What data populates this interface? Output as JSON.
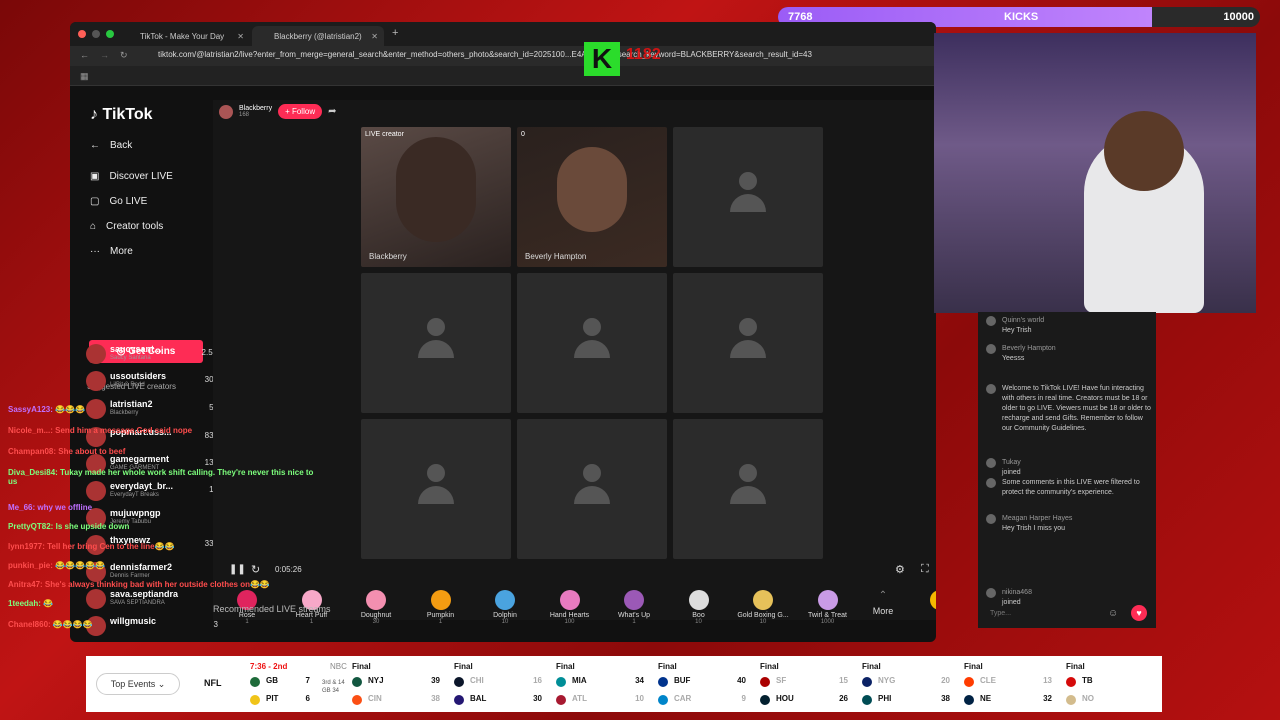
{
  "kicks": {
    "current": "7768",
    "label": "KICKS",
    "goal": "10000",
    "progress": 0.7768
  },
  "overlay": {
    "k_letter": "K",
    "k_count": "1182"
  },
  "browser": {
    "tabs": [
      {
        "title": "TikTok - Make Your Day"
      },
      {
        "title": "Blackberry (@latristian2)"
      }
    ],
    "url": "tiktok.com/@latristian2/live?enter_from_merge=general_search&enter_method=others_photo&search_id=2025100...E4AD1A3D&search_keyword=BLACKBERRY&search_result_id=43"
  },
  "tiktok": {
    "logo": "TikTok",
    "nav": [
      {
        "label": "Back",
        "icon": "back-arrow-icon"
      },
      {
        "label": "Discover LIVE",
        "icon": "live-icon"
      },
      {
        "label": "Go LIVE",
        "icon": "camera-icon"
      },
      {
        "label": "Creator tools",
        "icon": "tools-icon"
      },
      {
        "label": "More",
        "icon": "more-icon"
      }
    ],
    "get_coins": "Get Coins",
    "suggested_title": "Suggested LIVE creators",
    "creators": [
      {
        "name": "saucysant...",
        "sub": "Saucy Santana",
        "count": "2.5K"
      },
      {
        "name": "ussoutsiders",
        "sub": "LilBit & Redd",
        "count": "302"
      },
      {
        "name": "latristian2",
        "sub": "Blackberry",
        "count": "56"
      },
      {
        "name": "popmart.uss...",
        "sub": "",
        "count": "834"
      },
      {
        "name": "gamegarment",
        "sub": "GAME GARMENT",
        "count": "137"
      },
      {
        "name": "everydayt_br...",
        "sub": "EverydayT Breaks",
        "count": "14"
      },
      {
        "name": "mujuwpngp",
        "sub": "Jeremy Tabubu",
        "count": "4"
      },
      {
        "name": "thxynewz",
        "sub": "",
        "count": "332"
      },
      {
        "name": "dennisfarmer2",
        "sub": "Dennis Farmer",
        "count": "1"
      },
      {
        "name": "sava.septiandra",
        "sub": "SAVA SEPTIANDRA",
        "count": "7"
      },
      {
        "name": "willgmusic",
        "sub": "",
        "count": "3"
      }
    ],
    "host": {
      "name": "Blackberry",
      "likes": "168",
      "follow": "+ Follow"
    },
    "cells": [
      {
        "label": "LIVE creator",
        "name": "Blackberry"
      },
      {
        "label": "0",
        "name": "Beverly Hampton"
      }
    ],
    "timer": "0:05:26",
    "gifts": [
      {
        "name": "Rose",
        "price": "1",
        "color": "#e0245e"
      },
      {
        "name": "Heart Puff",
        "price": "1",
        "color": "#f7a8c8"
      },
      {
        "name": "Doughnut",
        "price": "30",
        "color": "#f38fb0"
      },
      {
        "name": "Pumpkin",
        "price": "1",
        "color": "#f39c12"
      },
      {
        "name": "Dolphin",
        "price": "10",
        "color": "#4aa3df"
      },
      {
        "name": "Hand Hearts",
        "price": "100",
        "color": "#e87ac0"
      },
      {
        "name": "What's Up",
        "price": "1",
        "color": "#9b59b6"
      },
      {
        "name": "Boo",
        "price": "10",
        "color": "#dddddd"
      },
      {
        "name": "Gold Boxing G...",
        "price": "10",
        "color": "#e6c15a"
      },
      {
        "name": "Twirl & Treat",
        "price": "1000",
        "color": "#c99be6"
      }
    ],
    "more": "More",
    "balance": "1",
    "recommended": "Recommended LIVE streams"
  },
  "chat": {
    "messages": [
      {
        "user": "Quinn's world",
        "text": "Hey Trish"
      },
      {
        "user": "Beverly Hampton",
        "text": "Yeesss"
      },
      {
        "user": "",
        "text": "Welcome to TikTok LIVE! Have fun interacting with others in real time. Creators must be 18 or older to go LIVE. Viewers must be 18 or older to recharge and send Gifts. Remember to follow our Community Guidelines."
      },
      {
        "user": "Tukay",
        "text": "joined"
      },
      {
        "user": "",
        "text": "Some comments in this LIVE were filtered to protect the community's experience."
      },
      {
        "user": "Meagan Harper Hayes",
        "text": "Hey Trish I miss you"
      },
      {
        "user": "nikina468",
        "text": "joined"
      }
    ],
    "placeholder": "Type..."
  },
  "twitch_chat": [
    {
      "user": "SassyA123:",
      "text": "😂😂😂",
      "color": "#c070ff"
    },
    {
      "user": "Nicole_m...:",
      "text": "Send him a message,God said nope",
      "color": "#ff4d4d"
    },
    {
      "user": "Champan08:",
      "text": "She about to beef",
      "color": "#ff4d4d"
    },
    {
      "user": "Diva_Desi84:",
      "text": "Tukay made her whole work shift calling. They're never this nice to us",
      "color": "#7dff7d"
    },
    {
      "user": "Me_66:",
      "text": "why we offline",
      "color": "#c070ff"
    },
    {
      "user": "PrettyQT82:",
      "text": "Is she upside down",
      "color": "#7dff7d"
    },
    {
      "user": "lynn1977:",
      "text": "Tell her bring Cen to the line😂😂",
      "color": "#ff4d4d"
    },
    {
      "user": "punkin_pie:",
      "text": "😂😂😂😂😂",
      "color": "#ff4d4d"
    },
    {
      "user": "Anitra47:",
      "text": "She's always thinking bad with her outside clothes on😂😂",
      "color": "#ff4d4d"
    },
    {
      "user": "1teedah:",
      "text": "😂",
      "color": "#7dff7d"
    },
    {
      "user": "Chanel860:",
      "text": "😂😂😂😂",
      "color": "#ff4d4d"
    }
  ],
  "ticker": {
    "top_events": "Top Events",
    "league": "NFL",
    "games": [
      {
        "status": "7:36 - 2nd",
        "net": "NBC",
        "a": "GB",
        "as": "7",
        "b": "PIT",
        "bs": "6",
        "note": "3rd & 14 GB 34",
        "ac": "#1e6b3a",
        "bc": "#f0c419",
        "live": true
      },
      {
        "status": "Final",
        "a": "NYJ",
        "as": "39",
        "b": "CIN",
        "bs": "38",
        "ac": "#125740",
        "bc": "#fb4f14",
        "awin": true
      },
      {
        "status": "Final",
        "a": "CHI",
        "as": "16",
        "b": "BAL",
        "bs": "30",
        "ac": "#0b162a",
        "bc": "#241773",
        "awin": false
      },
      {
        "status": "Final",
        "a": "MIA",
        "as": "34",
        "b": "ATL",
        "bs": "10",
        "ac": "#008e97",
        "bc": "#a71930",
        "awin": true
      },
      {
        "status": "Final",
        "a": "BUF",
        "as": "40",
        "b": "CAR",
        "bs": "9",
        "ac": "#00338d",
        "bc": "#0085ca",
        "awin": true
      },
      {
        "status": "Final",
        "a": "SF",
        "as": "15",
        "b": "HOU",
        "bs": "26",
        "ac": "#aa0000",
        "bc": "#03202f",
        "awin": false
      },
      {
        "status": "Final",
        "a": "NYG",
        "as": "20",
        "b": "PHI",
        "bs": "38",
        "ac": "#0b2265",
        "bc": "#004c54",
        "awin": false
      },
      {
        "status": "Final",
        "a": "CLE",
        "as": "13",
        "b": "NE",
        "bs": "32",
        "ac": "#ff3c00",
        "bc": "#002244",
        "awin": false
      },
      {
        "status": "Final",
        "a": "TB",
        "as": "",
        "b": "NO",
        "bs": "",
        "ac": "#d50a0a",
        "bc": "#d3bc8d",
        "awin": true
      }
    ]
  }
}
